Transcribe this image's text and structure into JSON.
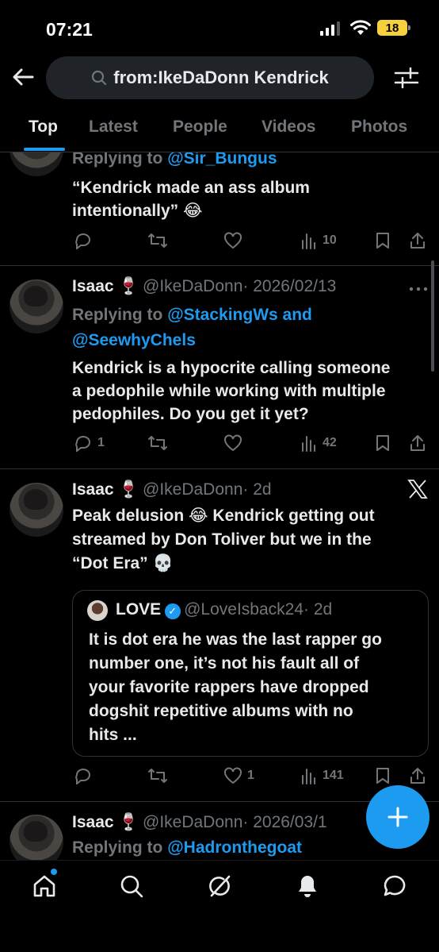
{
  "status_bar": {
    "time": "07:21",
    "battery": "18"
  },
  "header": {
    "query": "from:IkeDaDonn Kendrick"
  },
  "tabs": [
    "Top",
    "Latest",
    "People",
    "Videos",
    "Photos"
  ],
  "tweets": [
    {
      "reply_prefix": "Replying to",
      "reply_to": "@Sir_Bungus",
      "text_line1": "“Kendrick made an ass album",
      "text_line2": "intentionally” 😂",
      "reply_count": "",
      "like_count": "",
      "views": "10"
    },
    {
      "name": "Isaac 🍷",
      "handle": "@IkeDaDonn",
      "date": "· 2026/02/13",
      "reply_prefix": "Replying to",
      "reply_to_1": "@StackingWs",
      "reply_and": "and",
      "reply_to_2": "@SeewhyChels",
      "text_line1": "Kendrick is a hypocrite calling someone",
      "text_line2": "a pedophile while working with multiple",
      "text_line3": "pedophiles. Do you get it yet?",
      "reply_count": "1",
      "views": "42"
    },
    {
      "name": "Isaac 🍷",
      "handle": "@IkeDaDonn",
      "date": "· 2d",
      "text_line1": "Peak delusion 😂 Kendrick getting out",
      "text_line2": "streamed by Don Toliver but we in the",
      "text_line3": "“Dot Era” 💀",
      "quote": {
        "name": "LOVE",
        "handle": "@LoveIsback24",
        "date": "· 2d",
        "line1": "It is dot era he was the last rapper go",
        "line2": "number one, it’s not his fault all of",
        "line3": "your favorite rappers have dropped",
        "line4": "dogshit repetitive albums with no",
        "line5": "hits ..."
      },
      "like_count": "1",
      "views": "141"
    },
    {
      "name": "Isaac 🍷",
      "handle": "@IkeDaDonn",
      "date": "· 2026/03/1",
      "reply_prefix": "Replying to",
      "reply_to": "@Hadronthegoat"
    }
  ],
  "colors": {
    "accent": "#1d9bf0",
    "muted": "#71767b",
    "background": "#000000"
  },
  "icons": [
    "back-arrow-icon",
    "search-icon",
    "filter-sliders-icon",
    "reply-icon",
    "retweet-icon",
    "like-icon",
    "views-icon",
    "bookmark-icon",
    "share-icon",
    "more-icon",
    "x-logo-icon",
    "compose-plus-icon",
    "home-icon",
    "explore-icon",
    "grok-icon",
    "notifications-icon",
    "messages-icon"
  ]
}
